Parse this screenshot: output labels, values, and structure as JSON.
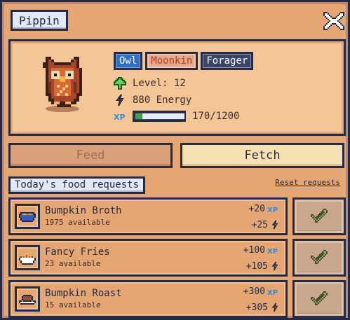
{
  "pet": {
    "name": "Pippin",
    "tags": {
      "type": "Owl",
      "specialty": "Moonkin",
      "role": "Forager"
    },
    "level_label": "Level: 12",
    "energy_label": "880 Energy",
    "xp_current": 170,
    "xp_max": 1200,
    "xp_text": "170/1200"
  },
  "tabs": {
    "feed": "Feed",
    "fetch": "Fetch",
    "active": "Fetch"
  },
  "requests": {
    "title": "Today's food requests",
    "reset_label": "Reset requests",
    "items": [
      {
        "name": "Bumpkin Broth",
        "available": "1975 available",
        "xp": "+20",
        "energy": "+25",
        "icon": "broth-bowl-icon"
      },
      {
        "name": "Fancy Fries",
        "available": "23 available",
        "xp": "+100",
        "energy": "+105",
        "icon": "fries-icon"
      },
      {
        "name": "Bumpkin Roast",
        "available": "15 available",
        "xp": "+300",
        "energy": "+305",
        "icon": "roast-icon"
      }
    ]
  },
  "colors": {
    "panel": "#e4a672",
    "card": "#f4c595",
    "outline": "#262b45",
    "xp_fill": "#3ea33e",
    "tag_type": "#2e70c7",
    "tag_role": "#3a4466",
    "xp_icon": "#2e8ae0",
    "energy_icon": "#262b45",
    "check": "#6b8f3a"
  },
  "icons": {
    "close": "close-x-icon",
    "level": "level-up-arrow-icon",
    "energy": "lightning-bolt-icon",
    "xp": "xp-badge-icon",
    "deliver": "checkmark-icon"
  }
}
